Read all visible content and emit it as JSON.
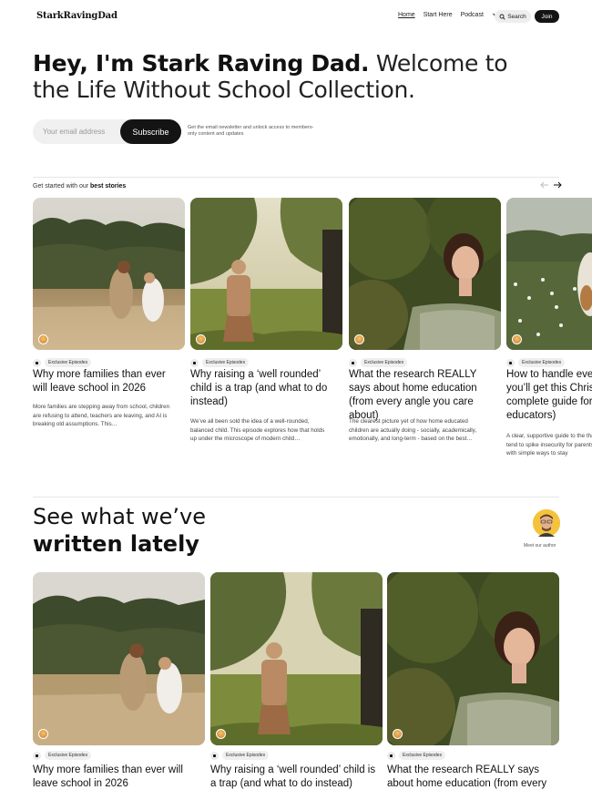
{
  "header": {
    "logo": "StarkRavingDad",
    "nav": [
      {
        "label": "Home",
        "active": true
      },
      {
        "label": "Start Here",
        "active": false
      },
      {
        "label": "Podcast",
        "active": false
      }
    ],
    "search_label": "Search",
    "join_label": "Join"
  },
  "hero": {
    "bold": "Hey, I'm Stark Raving Dad.",
    "light": " Welcome to the Life Without School Collection.",
    "email_placeholder": "Your email address",
    "subscribe_label": "Subscribe",
    "note": "Get the email newsletter and unlock access to members-only content and updates"
  },
  "best_stories": {
    "label_prefix": "Get started with our ",
    "label_bold": "best stories",
    "cards": [
      {
        "badge": "Exclusive Episodes",
        "title": "Why more families than ever will leave school in 2026",
        "excerpt": "More families are stepping away from school, children are refusing to attend, teachers are leaving, and AI is breaking old assumptions. This…",
        "image": "girls-running-field"
      },
      {
        "badge": "Exclusive Episodes",
        "title": "Why raising a ‘well rounded’ child is a trap (and what to do instead)",
        "excerpt": "We’ve all been sold the idea of a well-rounded, balanced child. This episode explores how that holds up under the microscope of modern child…",
        "image": "girl-standing-garden"
      },
      {
        "badge": "Exclusive Episodes",
        "title": "What the research REALLY says about home education (from every angle you care about)",
        "excerpt": "The clearest picture yet of how home educated children are actually doing - socially, academically, emotionally, and long-term - based on the best…",
        "image": "girl-portrait-trees"
      },
      {
        "badge": "Exclusive Episodes",
        "title": "How to handle ever you’ll get this Christ complete guide for educators)",
        "excerpt": "A clear, supportive guide to the that tend to spike insecurity for parents, with simple ways to stay",
        "image": "girl-flower-meadow"
      }
    ]
  },
  "latest": {
    "title_line1": "See what we’ve",
    "title_line2": "written lately",
    "author_label": "Meet our author",
    "cards": [
      {
        "badge": "Exclusive Episodes",
        "title": "Why more families than ever will leave school in 2026",
        "image": "girls-running-field"
      },
      {
        "badge": "Exclusive Episodes",
        "title": "Why raising a ‘well rounded’ child is a trap (and what to do instead)",
        "image": "girl-standing-garden"
      },
      {
        "badge": "Exclusive Episodes",
        "title": "What the research REALLY says about home education (from every",
        "image": "girl-portrait-trees"
      }
    ]
  },
  "icons": {
    "search": "search-icon",
    "chevron": "chevron-down-icon",
    "prev": "arrow-left-icon",
    "next": "arrow-right-icon",
    "lock": "lock-icon"
  }
}
